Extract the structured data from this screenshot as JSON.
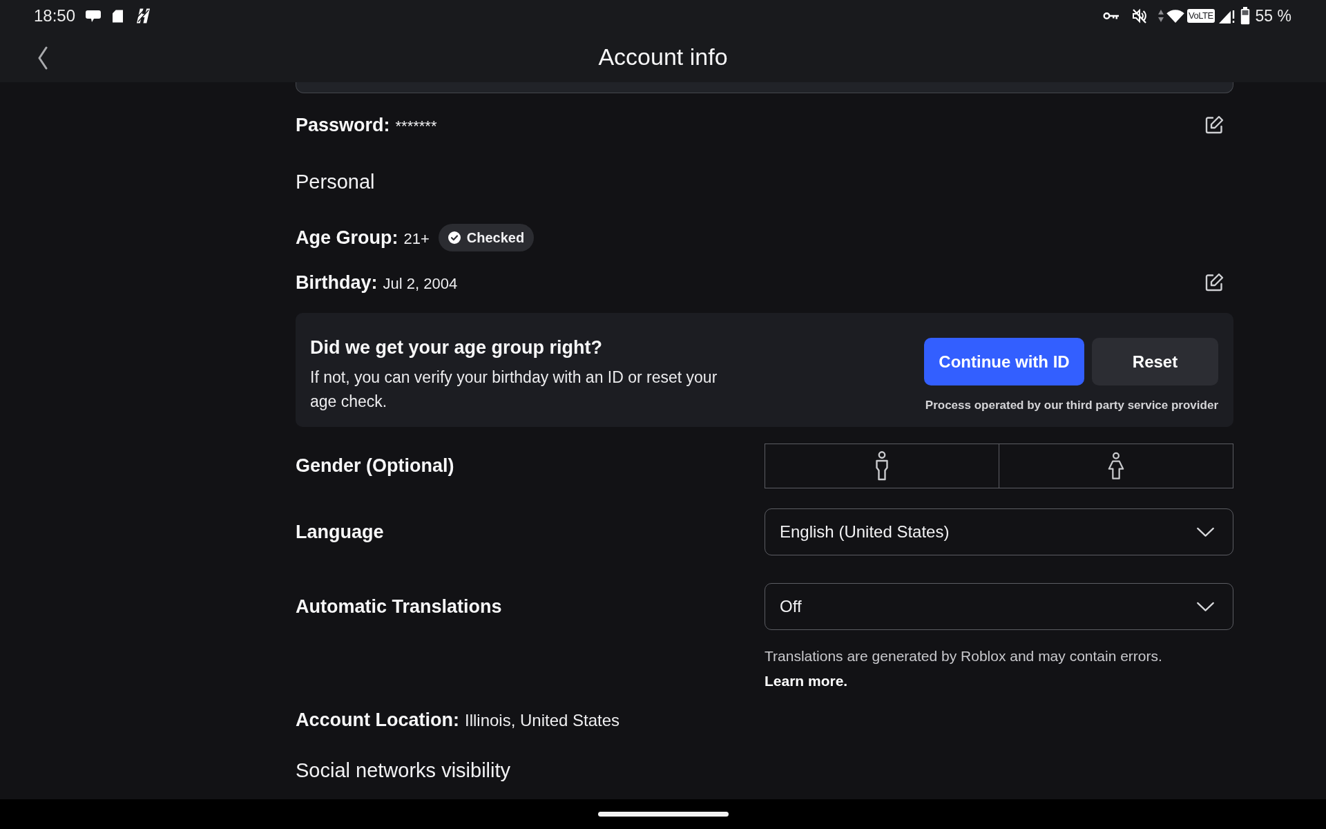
{
  "status_bar": {
    "time": "18:50",
    "volte": "VoLTE",
    "battery": "55 %"
  },
  "header": {
    "title": "Account info"
  },
  "password": {
    "label": "Password:",
    "value": "*******"
  },
  "personal": {
    "heading": "Personal"
  },
  "age_group": {
    "label": "Age Group:",
    "value": "21+",
    "badge": "Checked"
  },
  "birthday": {
    "label": "Birthday:",
    "value": "Jul 2, 2004"
  },
  "age_check": {
    "title": "Did we get your age group right?",
    "text": "If not, you can verify your birthday with an ID or reset your age check.",
    "buttons": [
      {
        "label": "Continue with ID",
        "kind": "primary"
      },
      {
        "label": "Reset",
        "kind": "secondary"
      }
    ],
    "note": "Process operated by our third party service provider"
  },
  "gender": {
    "label": "Gender (Optional)",
    "options": [
      {
        "kind": "male",
        "selected": false
      },
      {
        "kind": "female",
        "selected": false
      }
    ]
  },
  "language": {
    "label": "Language",
    "value": "English (United States)"
  },
  "automatic_translations": {
    "label": "Automatic Translations",
    "value": "Off",
    "note": "Translations are generated by Roblox and may contain errors.",
    "link": "Learn more."
  },
  "account_location": {
    "label": "Account Location:",
    "value": "Illinois, United States"
  },
  "social": {
    "heading": "Social networks visibility"
  }
}
